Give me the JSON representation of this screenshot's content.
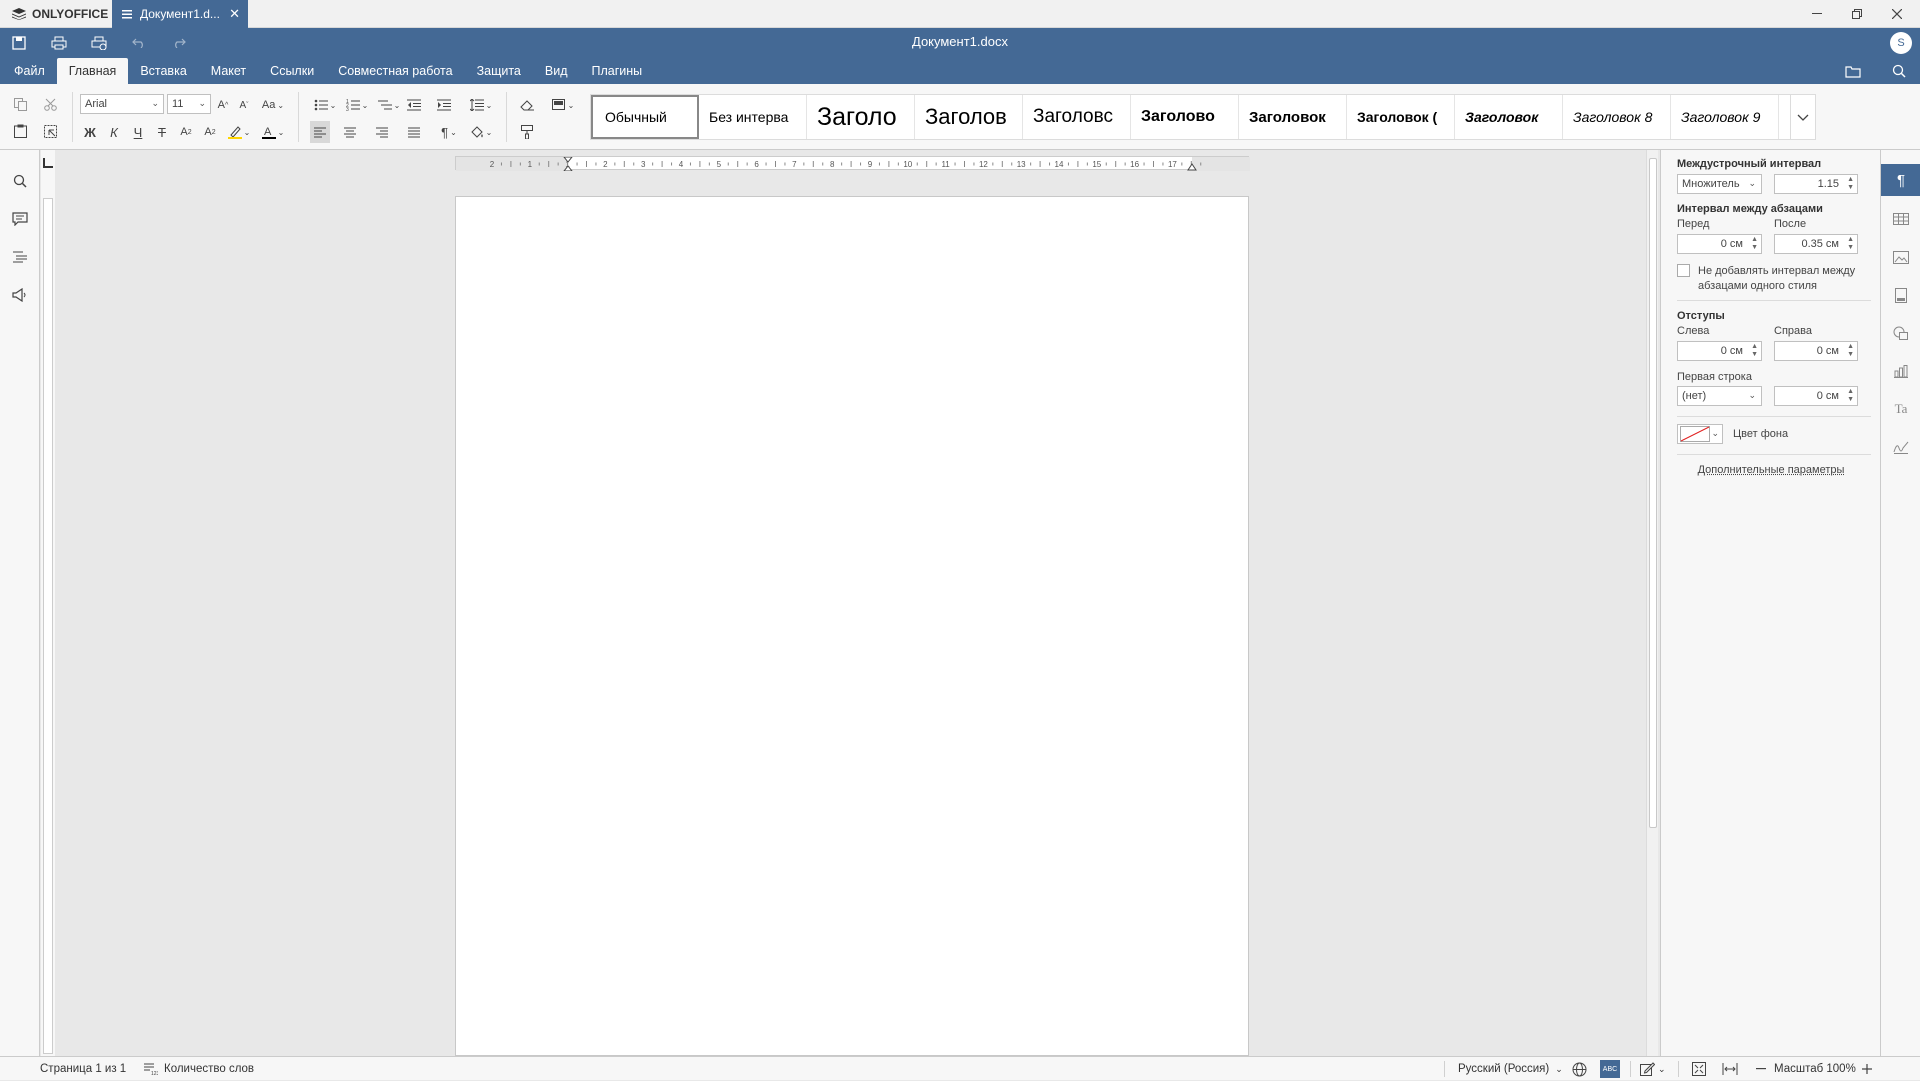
{
  "app": {
    "brand": "ONLYOFFICE",
    "tab_title": "Документ1.d...",
    "doc_title": "Документ1.docx",
    "avatar": "S"
  },
  "menu": {
    "tabs": [
      "Файл",
      "Главная",
      "Вставка",
      "Макет",
      "Ссылки",
      "Совместная работа",
      "Защита",
      "Вид",
      "Плагины"
    ],
    "active": "Главная"
  },
  "toolbar": {
    "font_name": "Arial",
    "font_size": "11",
    "bold": "Ж",
    "italic": "К",
    "underline": "Ч",
    "strike": "Т",
    "change_case": "Aa",
    "styles": [
      "Обычный",
      "Без интерва",
      "Заголо",
      "Заголов",
      "Заголовс",
      "Заголово",
      "Заголовок",
      "Заголовок (",
      "Заголовок",
      "Заголовок 8",
      "Заголовок 9"
    ]
  },
  "ruler": {
    "h_ticks": [
      "2",
      "1",
      "1",
      "2",
      "3",
      "4",
      "5",
      "6",
      "7",
      "8",
      "9",
      "10",
      "11",
      "12",
      "13",
      "14",
      "15",
      "16",
      "17"
    ]
  },
  "panel": {
    "line_spacing_title": "Междустрочный интервал",
    "line_spacing_mode": "Множитель",
    "line_spacing_value": "1.15",
    "para_spacing_title": "Интервал между абзацами",
    "before_label": "Перед",
    "after_label": "После",
    "before_value": "0 см",
    "after_value": "0.35 см",
    "no_space_label_1": "Не добавлять интервал между",
    "no_space_label_2": "абзацами одного стиля",
    "indents_title": "Отступы",
    "left_label": "Слева",
    "right_label": "Справа",
    "left_value": "0 см",
    "right_value": "0 см",
    "first_line_label": "Первая строка",
    "first_line_mode": "(нет)",
    "first_line_value": "0 см",
    "bg_color_label": "Цвет фона",
    "advanced_link": "Дополнительные параметры"
  },
  "status": {
    "page": "Страница 1 из 1",
    "word_count": "Количество слов",
    "language": "Русский (Россия)",
    "zoom": "Масштаб 100%"
  },
  "colors": {
    "accent": "#446995",
    "highlight": "#ffd500",
    "font_color": "#000000"
  }
}
